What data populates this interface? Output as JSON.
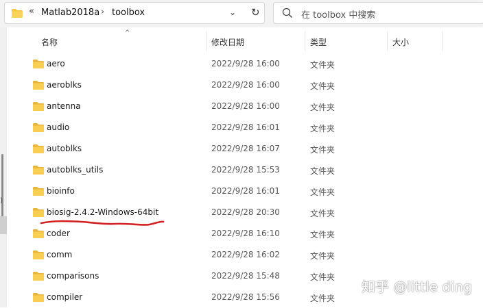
{
  "address_bar": {
    "overflow_chevron": "«",
    "crumbs": [
      "Matlab2018a",
      "toolbox"
    ],
    "separator": "›",
    "dropdown": "⌄",
    "refresh": "↻"
  },
  "search": {
    "placeholder": "在 toolbox 中搜索"
  },
  "left_pane": {
    "partial_text": ")"
  },
  "columns": {
    "name": "名称",
    "date": "修改日期",
    "type": "类型",
    "size": "大小",
    "sort_indicator": "^"
  },
  "rows": [
    {
      "name": "aero",
      "date": "2022/9/28 16:00",
      "type": "文件夹"
    },
    {
      "name": "aeroblks",
      "date": "2022/9/28 16:00",
      "type": "文件夹"
    },
    {
      "name": "antenna",
      "date": "2022/9/28 16:00",
      "type": "文件夹"
    },
    {
      "name": "audio",
      "date": "2022/9/28 16:01",
      "type": "文件夹"
    },
    {
      "name": "autoblks",
      "date": "2022/9/28 16:07",
      "type": "文件夹"
    },
    {
      "name": "autoblks_utils",
      "date": "2022/9/28 15:53",
      "type": "文件夹"
    },
    {
      "name": "bioinfo",
      "date": "2022/9/28 16:01",
      "type": "文件夹"
    },
    {
      "name": "biosig-2.4.2-Windows-64bit",
      "date": "2022/9/28 20:30",
      "type": "文件夹"
    },
    {
      "name": "coder",
      "date": "2022/9/28 16:10",
      "type": "文件夹"
    },
    {
      "name": "comm",
      "date": "2022/9/28 16:02",
      "type": "文件夹"
    },
    {
      "name": "comparisons",
      "date": "2022/9/28 15:48",
      "type": "文件夹"
    },
    {
      "name": "compiler",
      "date": "2022/9/28 15:56",
      "type": "文件夹"
    }
  ],
  "highlighted_row": "biosig-2.4.2-Windows-64bit",
  "watermark": "知乎 @little ding",
  "colors": {
    "folder": "#f5c542",
    "folder_dark": "#e0a92a",
    "underline": "#d42020",
    "toolbar_bg": "#f3f3f3"
  }
}
